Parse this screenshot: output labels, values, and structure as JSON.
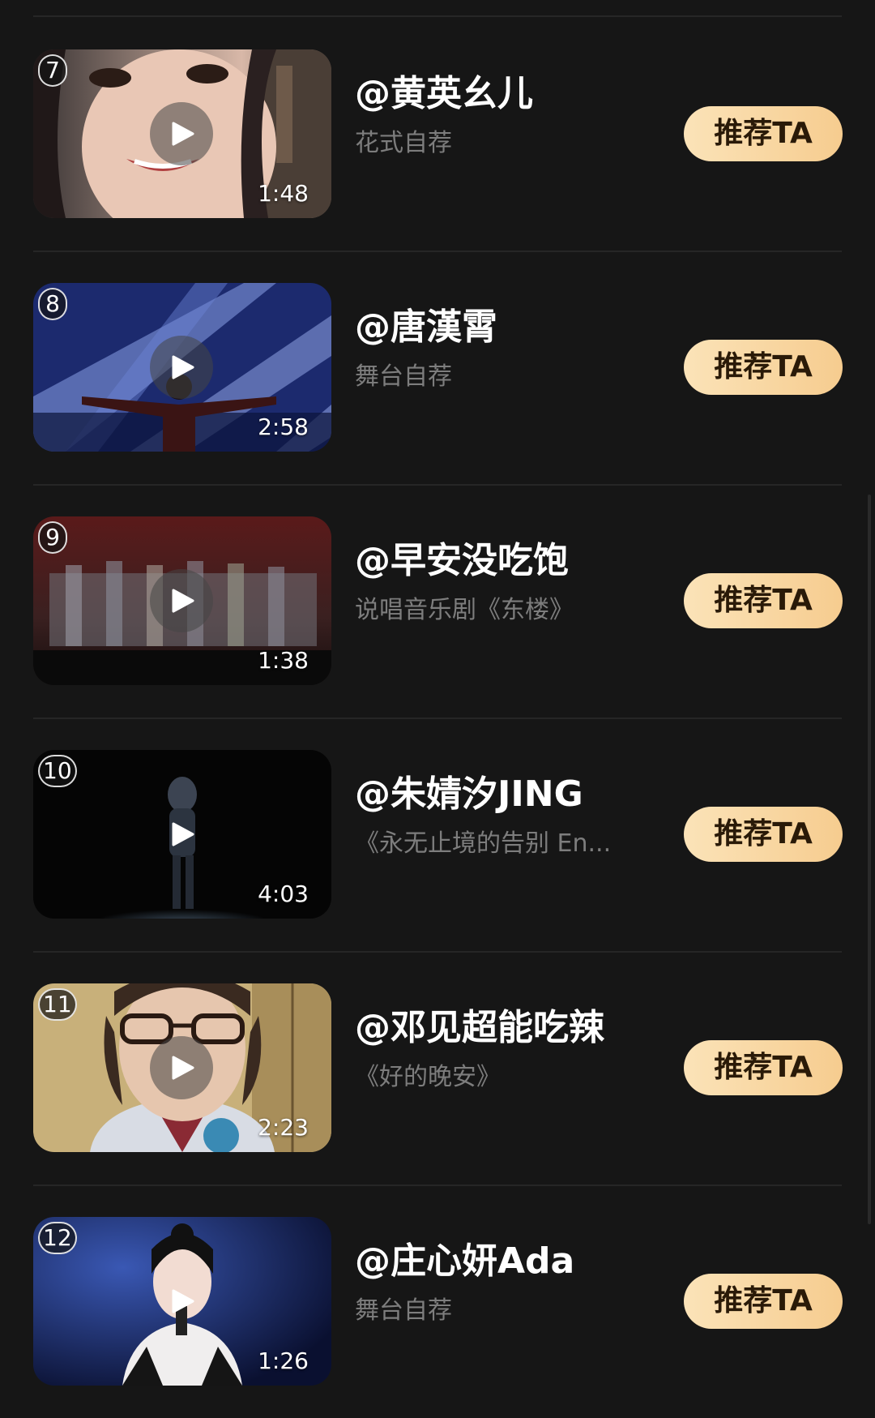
{
  "items": [
    {
      "rank": "7",
      "name": "@黄英幺儿",
      "desc": "花式自荐",
      "duration": "1:48",
      "button": "推荐TA"
    },
    {
      "rank": "8",
      "name": "@唐漢霄",
      "desc": "舞台自荐",
      "duration": "2:58",
      "button": "推荐TA"
    },
    {
      "rank": "9",
      "name": "@早安没吃饱",
      "desc": "说唱音乐剧《东楼》",
      "duration": "1:38",
      "button": "推荐TA"
    },
    {
      "rank": "10",
      "name": "@朱婧汐JING",
      "desc": "《永无止境的告别 En...",
      "duration": "4:03",
      "button": "推荐TA"
    },
    {
      "rank": "11",
      "name": "@邓见超能吃辣",
      "desc": "《好的晚安》",
      "duration": "2:23",
      "button": "推荐TA"
    },
    {
      "rank": "12",
      "name": "@庄心妍Ada",
      "desc": "舞台自荐",
      "duration": "1:26",
      "button": "推荐TA"
    }
  ],
  "colors": {
    "background": "#161616",
    "button_start": "#fbe3b8",
    "button_end": "#f6cc8f",
    "subtitle": "#7d7d7d"
  },
  "icons": {
    "play": "play-icon"
  }
}
